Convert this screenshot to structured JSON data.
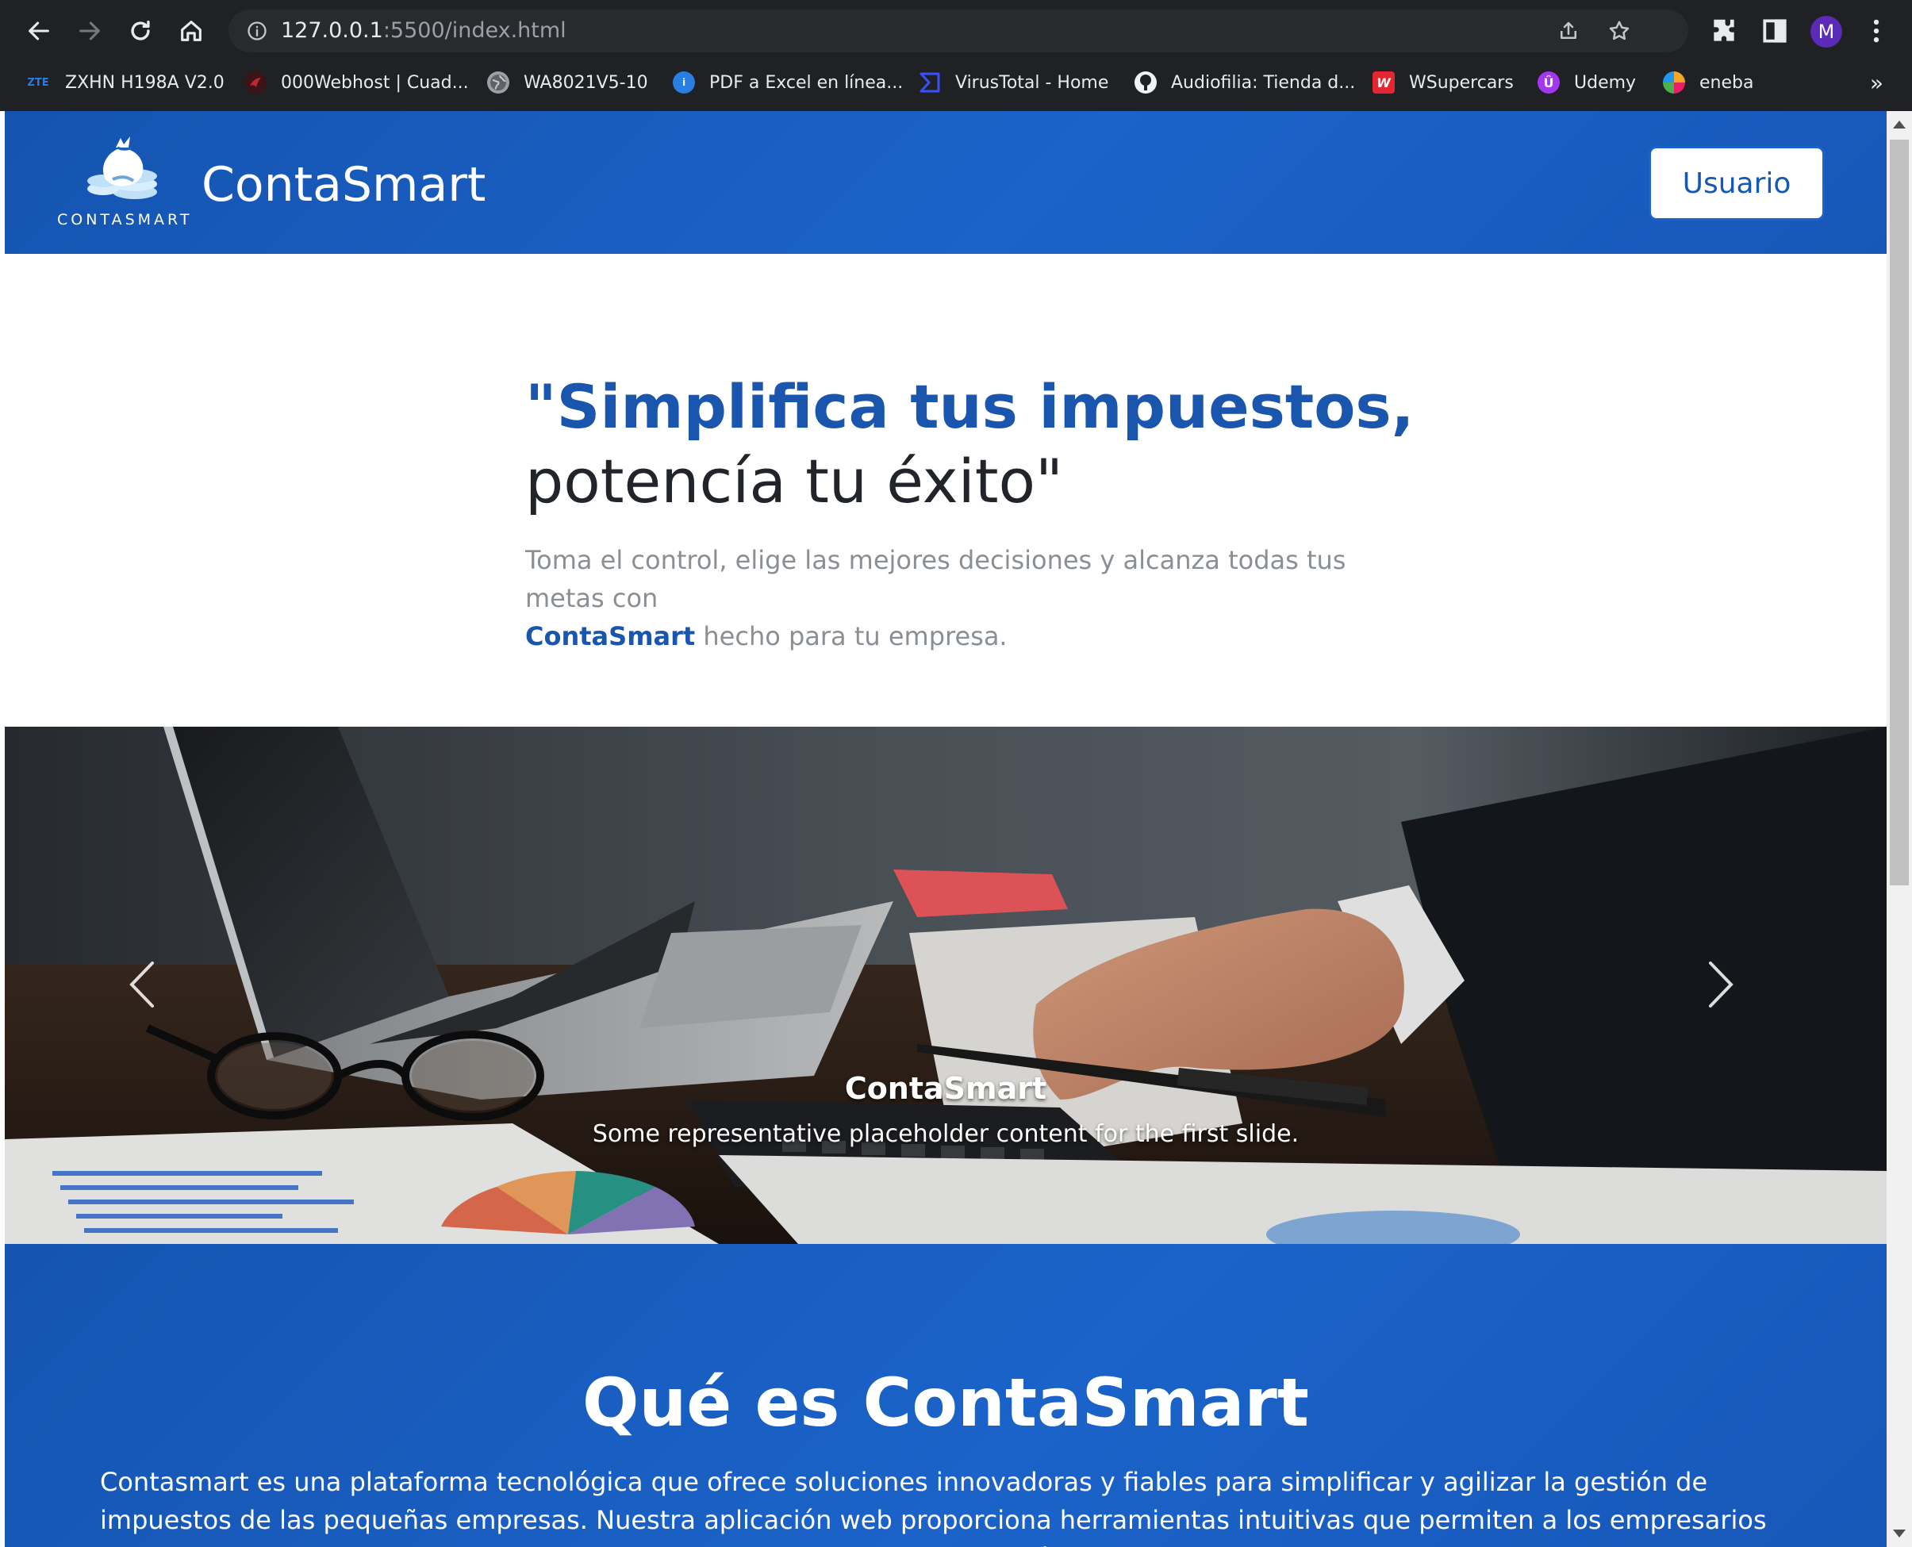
{
  "browser": {
    "url_host": "127.0.0.1",
    "url_rest": ":5500/index.html",
    "avatar_letter": "M",
    "bookmarks": [
      {
        "label": "ZXHN H198A V2.0",
        "icon": "zte-icon",
        "fav_text": "ZTE",
        "color": "#1e73be"
      },
      {
        "label": "000Webhost | Cuad...",
        "icon": "webhost-icon",
        "fav_text": "",
        "color": "#c0262d"
      },
      {
        "label": "WA8021V5-10",
        "icon": "globe-icon",
        "fav_text": "",
        "color": "#9aa0a6"
      },
      {
        "label": "PDF a Excel en línea...",
        "icon": "pdf-excel-icon",
        "fav_text": "i",
        "color": "#2a7de1"
      },
      {
        "label": "VirusTotal - Home",
        "icon": "virustotal-icon",
        "fav_text": "",
        "color": "#394eff"
      },
      {
        "label": "Audiofilia: Tienda d...",
        "icon": "audiofilia-icon",
        "fav_text": "",
        "color": "#f1f3f4"
      },
      {
        "label": "WSupercars",
        "icon": "wsupercars-icon",
        "fav_text": "W",
        "color": "#e3262f"
      },
      {
        "label": "Udemy",
        "icon": "udemy-icon",
        "fav_text": "Û",
        "color": "#a435f0"
      },
      {
        "label": "eneba",
        "icon": "eneba-icon",
        "fav_text": "",
        "color": "#f5a623"
      }
    ],
    "more": "»"
  },
  "header": {
    "logo_word": "CONTASMART",
    "brand": "ContaSmart",
    "user_button": "Usuario"
  },
  "hero": {
    "title_blue": "\"Simplifica tus impuestos,",
    "title_dark": "potencía tu éxito\"",
    "text_before": "Toma el control, elige las mejores decisiones y alcanza todas tus metas con",
    "text_brand": "ContaSmart",
    "text_after": " hecho para tu empresa."
  },
  "carousel": {
    "caption_title": "ContaSmart",
    "caption_text": "Some representative placeholder content for the first slide."
  },
  "about": {
    "title": "Qué es ContaSmart",
    "text": "Contasmart es una plataforma tecnológica que ofrece soluciones innovadoras y fiables para simplificar y agilizar la gestión de impuestos de las pequeñas empresas. Nuestra aplicación web proporciona herramientas intuitivas que permiten a los empresarios llevar un control preciso de sus transacciones financieras, generar automáticamente formularios y reportes fiscales, y presentar sus declaraciones de impuestos de manera segura y"
  },
  "colors": {
    "brand_blue": "#1b63c9",
    "title_blue": "#1a56ad",
    "chrome_bg": "#202124"
  }
}
